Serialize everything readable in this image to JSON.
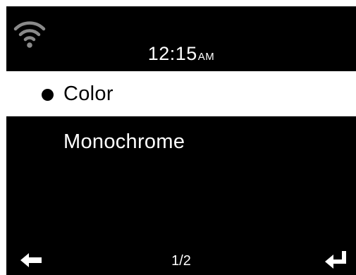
{
  "status_bar": {
    "wifi_icon": "wifi-icon",
    "time": "12:15",
    "ampm": "AM"
  },
  "menu": {
    "items": [
      {
        "label": "Color",
        "selected": true
      },
      {
        "label": "Monochrome",
        "selected": false
      }
    ]
  },
  "footer": {
    "back_icon": "back-arrow-icon",
    "page_indicator": "1/2",
    "enter_icon": "enter-return-icon"
  },
  "colors": {
    "background": "#000000",
    "foreground": "#ffffff",
    "highlight_background": "#ffffff",
    "highlight_text": "#000000"
  }
}
